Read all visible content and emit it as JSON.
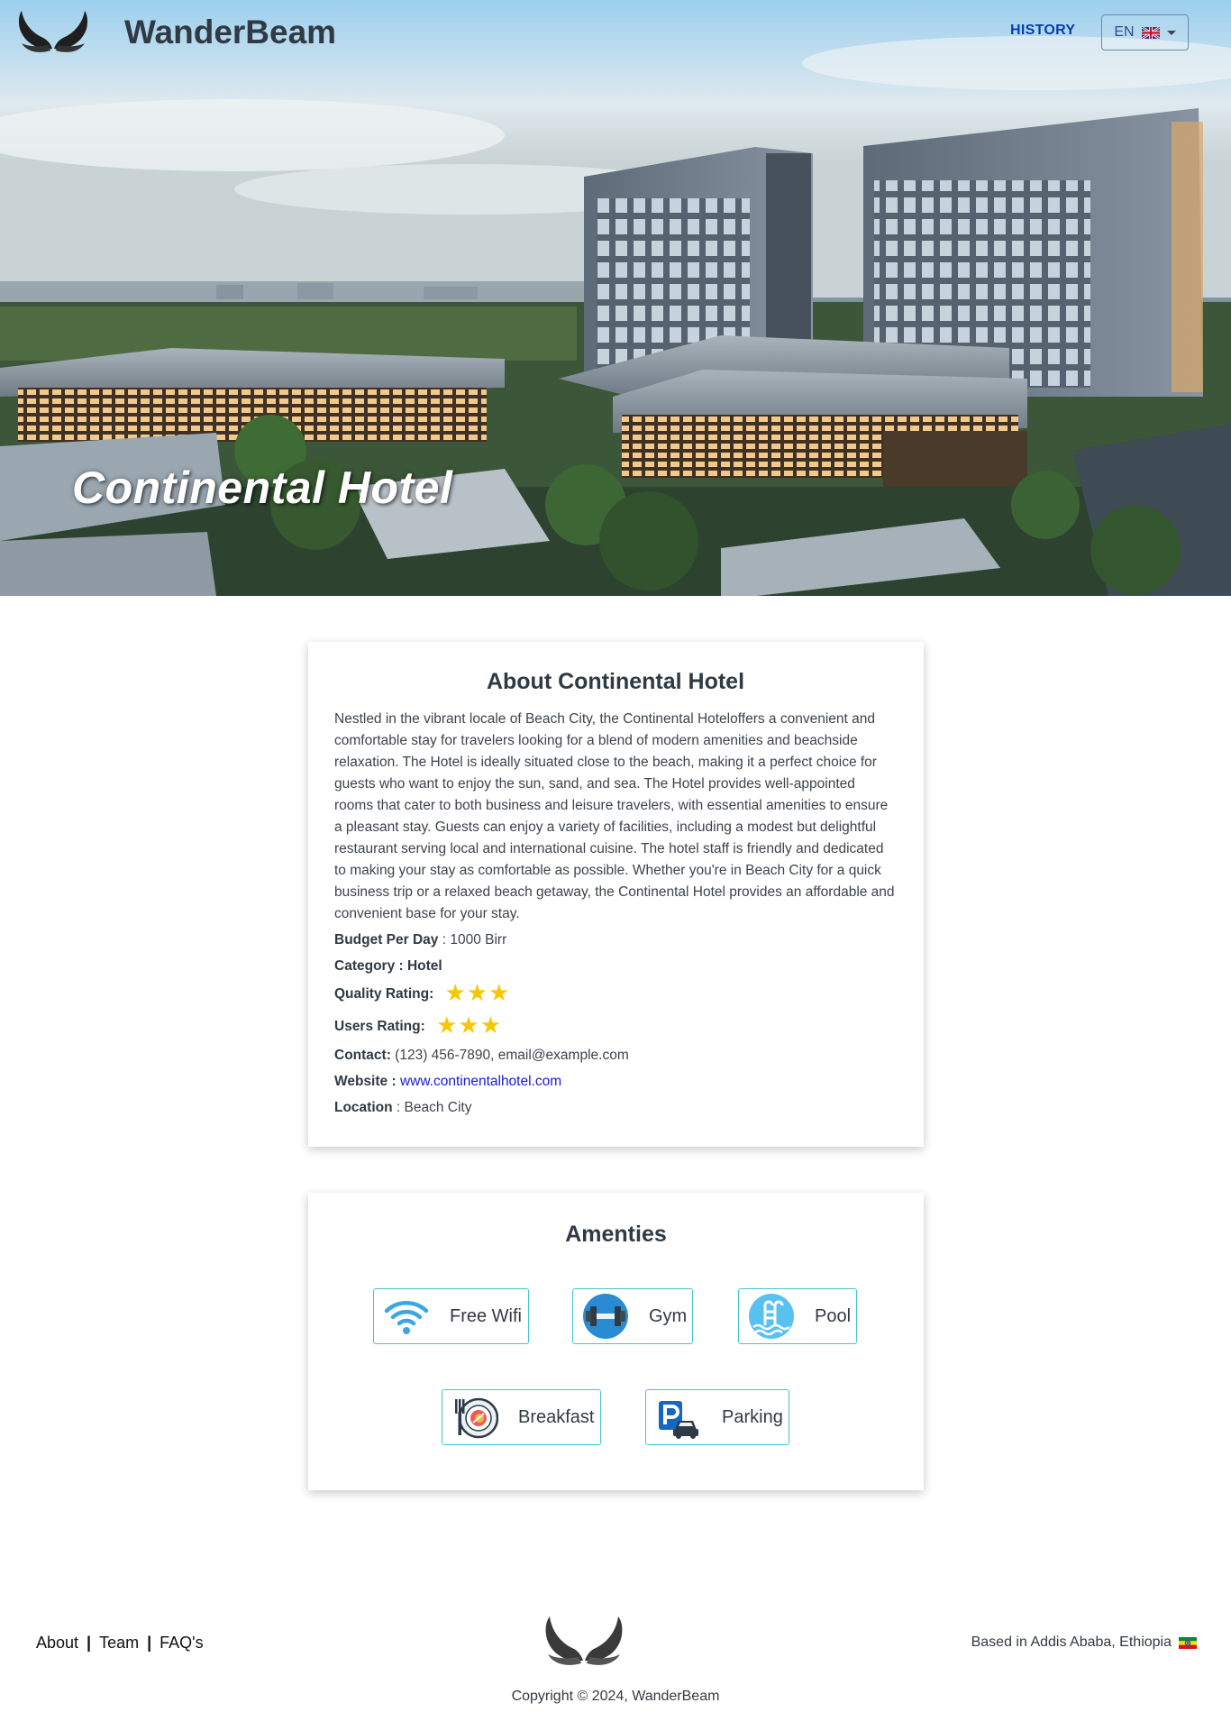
{
  "brand": {
    "name": "WanderBeam"
  },
  "nav": {
    "history": "HISTORY",
    "language": "EN"
  },
  "hero": {
    "title": "Continental Hotel"
  },
  "about": {
    "heading": "About Continental Hotel",
    "description": "Nestled in the vibrant locale of Beach City, the Continental Hoteloffers a convenient and comfortable stay for travelers looking for a blend of modern amenities and beachside relaxation. The Hotel is ideally situated close to the beach, making it a perfect choice for guests who want to enjoy the sun, sand, and sea. The Hotel provides well-appointed rooms that cater to both business and leisure travelers, with essential amenities to ensure a pleasant stay. Guests can enjoy a variety of facilities, including a modest but delightful restaurant serving local and international cuisine. The hotel staff is friendly and dedicated to making your stay as comfortable as possible. Whether you're in Beach City for a quick business trip or a relaxed beach getaway, the Continental Hotel provides an affordable and convenient base for your stay.",
    "budget_label": "Budget Per Day",
    "budget_value": ": 1000 Birr",
    "category_label": "Category : Hotel",
    "quality_label": "Quality Rating:",
    "quality_rating": 3,
    "users_label": "Users Rating:",
    "users_rating": 3,
    "contact_label": "Contact:",
    "contact_value": "(123) 456-7890, email@example.com",
    "website_label": "Website :",
    "website_value": "www.continentalhotel.com",
    "location_label": "Location",
    "location_value": ": Beach City",
    "star_color": "#f6c706"
  },
  "amenities": {
    "heading": "Amenties",
    "items": [
      {
        "label": "Free Wifi",
        "icon": "wifi-icon"
      },
      {
        "label": "Gym",
        "icon": "dumbbell-icon"
      },
      {
        "label": "Pool",
        "icon": "pool-ladder-icon"
      },
      {
        "label": "Breakfast",
        "icon": "breakfast-plate-icon"
      },
      {
        "label": "Parking",
        "icon": "parking-icon"
      }
    ],
    "border_color": "#43c4cf"
  },
  "footer": {
    "links": [
      "About",
      "Team",
      "FAQ's"
    ],
    "based": "Based in Addis Ababa, Ethiopia",
    "copyright": "Copyright © 2024, WanderBeam"
  }
}
